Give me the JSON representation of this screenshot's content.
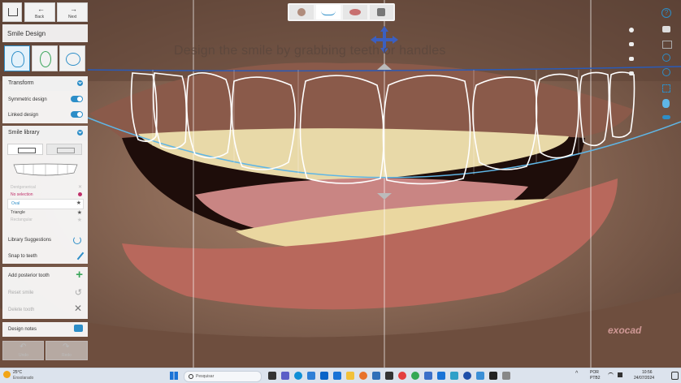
{
  "nav": {
    "back_label": "Back",
    "next_label": "Next"
  },
  "panel_title": "Smile Design",
  "instruction": "Design the smile by grabbing teeth or handles",
  "transform": {
    "title": "Transform",
    "symmetric_label": "Symmetric design",
    "linked_label": "Linked design"
  },
  "smile_library": {
    "title": "Smile library",
    "items": [
      "Dentgenerical",
      "No selection",
      "Oval",
      "Triangle",
      "Rectangular"
    ],
    "selected": "Oval",
    "library_suggestions": "Library Suggestions",
    "snap_to_teeth": "Snap to teeth"
  },
  "tooth_actions": {
    "add_posterior": "Add posterior tooth",
    "reset_smile": "Reset smile",
    "delete_tooth": "Delete tooth"
  },
  "design_notes": "Design notes",
  "undo": "Undo",
  "redo": "Redo",
  "brand": "exocad",
  "taskbar": {
    "weather_temp": "25°C",
    "weather_desc": "Ensolarado",
    "search_placeholder": "Pesquisar",
    "lang": "POR",
    "lang2": "PTB2",
    "time": "10:56",
    "date": "24/07/2024"
  },
  "colors": {
    "accent": "#2d8ec8",
    "arc_blue": "#2a5bb8",
    "arc_light": "#5fb6e6",
    "tooth_outline": "#ffffff"
  }
}
